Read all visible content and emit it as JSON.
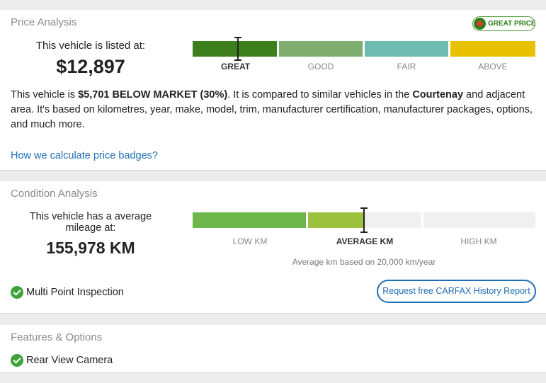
{
  "price": {
    "title": "Price Analysis",
    "badge_label": "GREAT PRICE",
    "listed_label": "This vehicle is listed at:",
    "price_value": "$12,897",
    "segments": [
      {
        "label": "GREAT",
        "color": "#3d7f1c",
        "active": true
      },
      {
        "label": "GOOD",
        "color": "#7fad6f",
        "active": false
      },
      {
        "label": "FAIR",
        "color": "#6dbbb1",
        "active": false
      },
      {
        "label": "ABOVE",
        "color": "#e8c200",
        "active": false
      }
    ],
    "description": {
      "part1": "This vehicle is ",
      "amount": "$5,701 BELOW MARKET (30%)",
      "part2": ". It is compared to similar vehicles in the ",
      "location": "Courtenay",
      "part3": " and adjacent area. It's based on kilometres, year, make, model, trim, manufacturer certification, manufacturer packages, options, and much more."
    },
    "link_label": "How we calculate price badges?"
  },
  "condition": {
    "title": "Condition Analysis",
    "mileage_label": "This vehicle has a average mileage at:",
    "mileage_value": "155,978 KM",
    "segments": [
      {
        "label": "LOW KM",
        "color": "#6db64a",
        "active": false
      },
      {
        "label": "AVERAGE KM",
        "color": "#9cc23e",
        "active": true
      },
      {
        "label": "HIGH KM",
        "color": "#f0f0f0",
        "active": false
      }
    ],
    "note": "Average km based on 20,000 km/year",
    "inspection_label": "Multi Point Inspection",
    "carfax_button": "Request free CARFAX History Report"
  },
  "features": {
    "title": "Features & Options",
    "items": [
      "Rear View Camera"
    ]
  },
  "colors": {
    "link_blue": "#1f6fb5",
    "check_green": "#3ea33a",
    "badge_green": "#2e7d18"
  }
}
